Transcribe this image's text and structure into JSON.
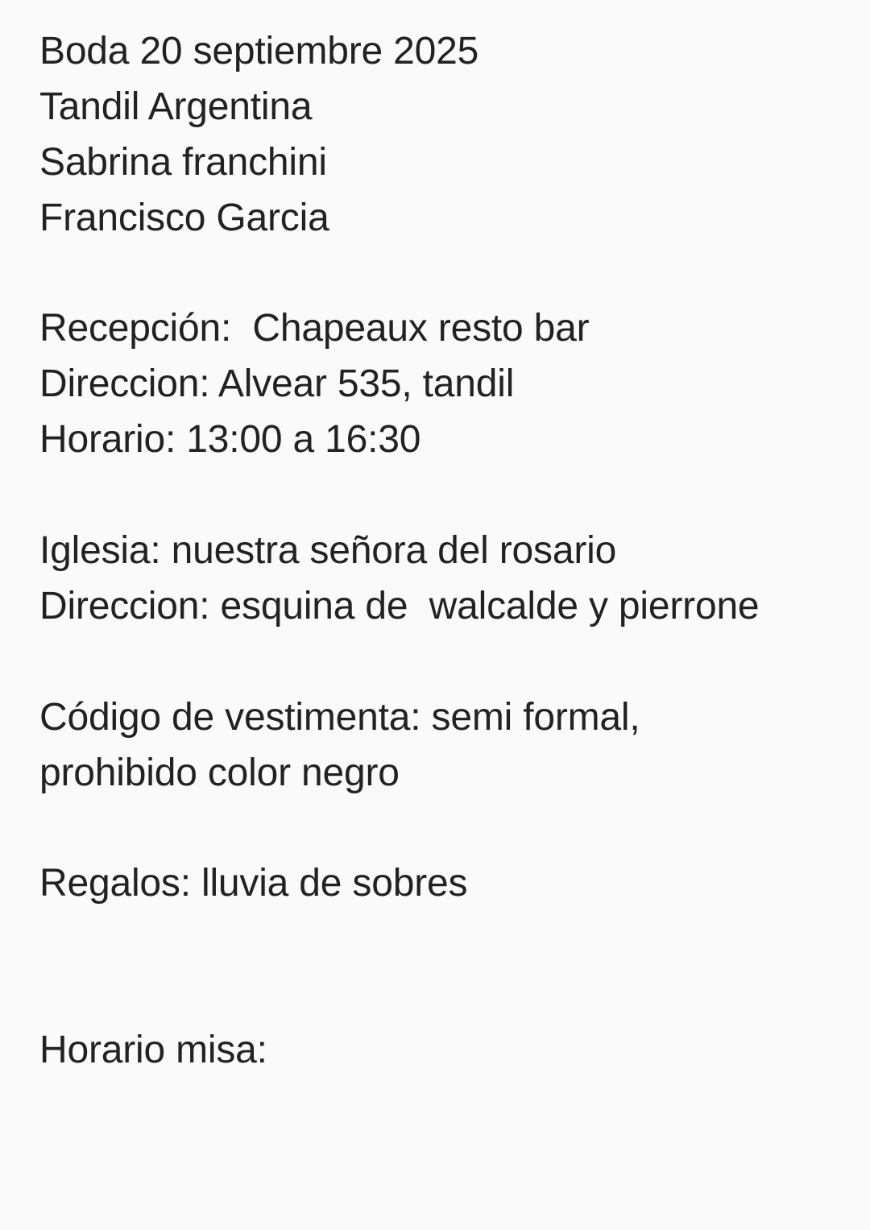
{
  "note": {
    "title": "Boda 20 septiembre 2025",
    "location": "Tandil Argentina",
    "name_1": "Sabrina franchini",
    "name_2": "Francisco Garcia",
    "reception": "Recepción:  Chapeaux resto bar",
    "reception_address": "Direccion: Alvear 535, tandil",
    "reception_hours": "Horario: 13:00 a 16:30",
    "church": "Iglesia: nuestra señora del rosario",
    "church_address": "Direccion: esquina de  walcalde y pierrone",
    "dress_code_1": "Código de vestimenta: semi formal,",
    "dress_code_2": "prohibido color negro",
    "gifts": "Regalos: lluvia de sobres",
    "mass_time": "Horario misa:"
  },
  "colors": {
    "background": "#fafafa",
    "text": "#222222"
  }
}
